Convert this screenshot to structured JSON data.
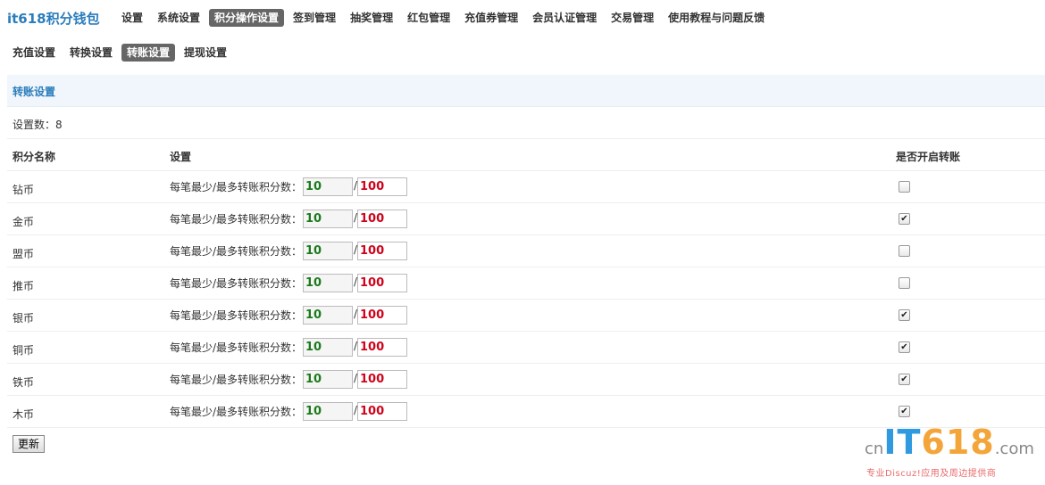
{
  "app": {
    "brand": "it618积分钱包"
  },
  "topnav": {
    "items": [
      {
        "label": "设置",
        "active": false
      },
      {
        "label": "系统设置",
        "active": false
      },
      {
        "label": "积分操作设置",
        "active": true
      },
      {
        "label": "签到管理",
        "active": false
      },
      {
        "label": "抽奖管理",
        "active": false
      },
      {
        "label": "红包管理",
        "active": false
      },
      {
        "label": "充值券管理",
        "active": false
      },
      {
        "label": "会员认证管理",
        "active": false
      },
      {
        "label": "交易管理",
        "active": false
      },
      {
        "label": "使用教程与问题反馈",
        "active": false
      }
    ]
  },
  "subnav": {
    "items": [
      {
        "label": "充值设置",
        "active": false
      },
      {
        "label": "转换设置",
        "active": false
      },
      {
        "label": "转账设置",
        "active": true
      },
      {
        "label": "提现设置",
        "active": false
      }
    ]
  },
  "section": {
    "title": "转账设置",
    "count_text": "设置数：8"
  },
  "table": {
    "headers": [
      "积分名称",
      "设置",
      "是否开启转账"
    ],
    "setting_label": "每笔最少/最多转账积分数：",
    "separator": "/",
    "rows": [
      {
        "name": "钻币",
        "min": "10",
        "max": "100",
        "enabled": false
      },
      {
        "name": "金币",
        "min": "10",
        "max": "100",
        "enabled": true
      },
      {
        "name": "盟币",
        "min": "10",
        "max": "100",
        "enabled": false
      },
      {
        "name": "推币",
        "min": "10",
        "max": "100",
        "enabled": false
      },
      {
        "name": "银币",
        "min": "10",
        "max": "100",
        "enabled": true
      },
      {
        "name": "铜币",
        "min": "10",
        "max": "100",
        "enabled": true
      },
      {
        "name": "铁币",
        "min": "10",
        "max": "100",
        "enabled": true
      },
      {
        "name": "木币",
        "min": "10",
        "max": "100",
        "enabled": true
      }
    ]
  },
  "actions": {
    "update_label": "更新"
  },
  "watermark": {
    "cn": "cn",
    "it": "IT",
    "num": "618",
    "com": ".com",
    "tagline": "专业Discuz!应用及周边提供商"
  },
  "colors": {
    "accent": "#2b7dbc",
    "min_value": "#1c7a1c",
    "max_value": "#d0021b",
    "active_tab": "#666666"
  }
}
